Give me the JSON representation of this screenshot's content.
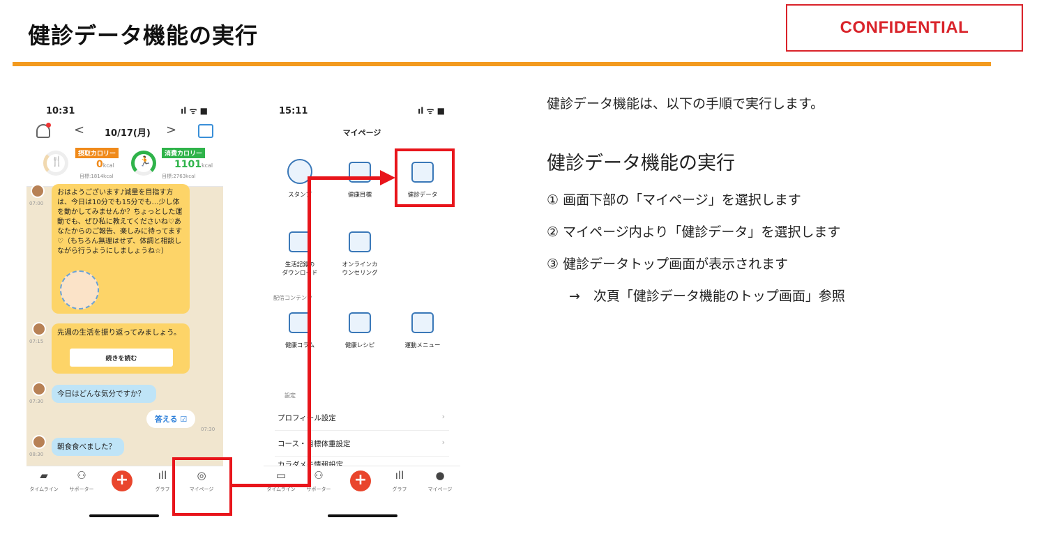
{
  "slide": {
    "title": "健診データ機能の実行",
    "confidential": "CONFIDENTIAL",
    "accent_color": "#f39a1e",
    "highlight_color": "#e8151b"
  },
  "phone1": {
    "status_time": "10:31",
    "status_icons": "ıl ᯤ ■",
    "header": {
      "prev": "<",
      "date": "10/17(月)",
      "next": ">"
    },
    "calorie_in": {
      "label": "摂取カロリー",
      "value": "0",
      "unit": "kcal",
      "goal": "目標:1814kcal"
    },
    "calorie_out": {
      "label": "消費カロリー",
      "value": "1101",
      "unit": "kcal",
      "goal": "目標:2763kcal"
    },
    "messages": [
      {
        "time": "07:00",
        "text": "おはようございます♪減量を目指す方は、今日は10分でも15分でも…少し体を動かしてみませんか？ちょっとした運動でも、ぜひ私に教えてくださいね♡あなたからのご報告、楽しみに待ってます♡（もちろん無理はせず、体調と相談しながら行うようにしましょうね☆）"
      },
      {
        "time": "07:15",
        "text": "先週の生活を振り返ってみましょう。",
        "button": "続きを読む"
      },
      {
        "time": "07:30",
        "text": "今日はどんな気分ですか？"
      },
      {
        "time": "07:30",
        "text": "答える"
      },
      {
        "time": "08:30",
        "text": "朝食食べました？"
      }
    ],
    "tabs": [
      "タイムライン",
      "サポーター",
      "",
      "グラフ",
      "マイページ"
    ]
  },
  "phone2": {
    "status_time": "15:11",
    "status_icons": "ıl ᯤ ■",
    "title": "マイページ",
    "grid": [
      "スタンプ",
      "健康目標",
      "健診データ",
      "生活記録の\nダウンロード",
      "オンラインカ\nウンセリング"
    ],
    "content_section": "配信コンテンツ",
    "content_items": [
      "健康コラム",
      "健康レシピ",
      "運動メニュー"
    ],
    "settings_section": "設定",
    "settings_rows": [
      "プロフィール設定",
      "コース・目標体重設定",
      "カラダメモ情報設定"
    ],
    "tabs": [
      "タイムライン",
      "サポーター",
      "",
      "グラフ",
      "マイページ"
    ]
  },
  "instructions": {
    "intro": "健診データ機能は、以下の手順で実行します。",
    "subtitle": "健診データ機能の実行",
    "steps": [
      "① 画面下部の「マイページ」を選択します",
      "② マイページ内より「健診データ」を選択します",
      "③ 健診データトップ画面が表示されます"
    ],
    "note": "→　次頁「健診データ機能のトップ画面」参照"
  }
}
